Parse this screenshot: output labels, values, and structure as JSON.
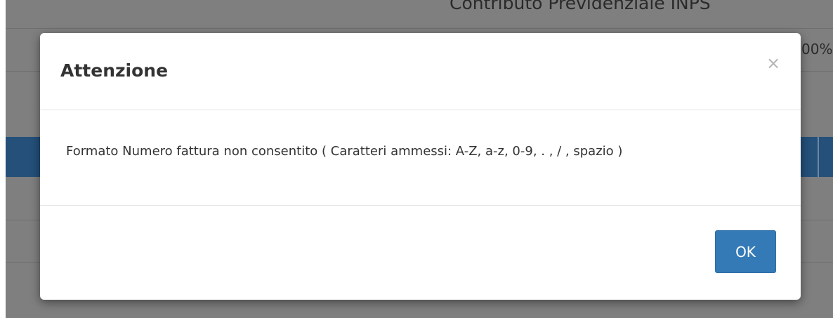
{
  "background": {
    "header_text": "Contributo Previdenziale INPS",
    "percent_text": "00%"
  },
  "dialog": {
    "title": "Attenzione",
    "close_symbol": "×",
    "message": "Formato Numero fattura non consentito ( Caratteri ammessi: A-Z, a-z, 0-9, . , / , spazio )",
    "ok_label": "OK"
  },
  "colors": {
    "primary_button": "#337ab7",
    "overlay": "#7f7f7f",
    "table_header": "#24507a"
  },
  "icons": {
    "close": "close-icon"
  }
}
